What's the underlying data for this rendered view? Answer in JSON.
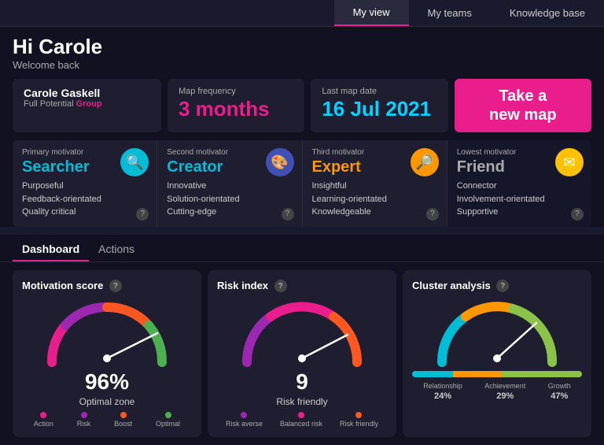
{
  "nav": {
    "tabs": [
      {
        "id": "my-view",
        "label": "My view",
        "active": true
      },
      {
        "id": "my-teams",
        "label": "My teams",
        "active": false
      },
      {
        "id": "knowledge-base",
        "label": "Knowledge base",
        "active": false
      }
    ]
  },
  "header": {
    "greeting": "Hi Carole",
    "welcome": "Welcome back"
  },
  "stats": {
    "user": {
      "name": "Carole Gaskell",
      "group_pre": "Full Potential ",
      "group_highlight": "Group"
    },
    "map_frequency": {
      "label": "Map frequency",
      "value": "3 months"
    },
    "last_map": {
      "label": "Last map date",
      "value": "16 Jul 2021"
    },
    "cta": {
      "line1": "Take a",
      "line2": "new map"
    }
  },
  "motivators": [
    {
      "label": "Primary motivator",
      "name": "Searcher",
      "color": "cyan",
      "icon": "🔍",
      "icon_color": "teal",
      "traits": [
        "Purposeful",
        "Feedback-orientated",
        "Quality critical"
      ]
    },
    {
      "label": "Second motivator",
      "name": "Creator",
      "color": "teal",
      "icon": "🎨",
      "icon_color": "blue",
      "traits": [
        "Innovative",
        "Solution-orientated",
        "Cutting-edge"
      ]
    },
    {
      "label": "Third motivator",
      "name": "Expert",
      "color": "orange",
      "icon": "🔎",
      "icon_color": "orange",
      "traits": [
        "Insightful",
        "Learning-orientated",
        "Knowledgeable"
      ]
    },
    {
      "label": "Lowest motivator",
      "name": "Friend",
      "color": "gray",
      "icon": "✉",
      "icon_color": "yellow",
      "traits": [
        "Connector",
        "Involvement-orientated",
        "Supportive"
      ],
      "lowest": true
    }
  ],
  "dashboard_tabs": [
    {
      "id": "dashboard",
      "label": "Dashboard",
      "active": true
    },
    {
      "id": "actions",
      "label": "Actions",
      "active": false
    }
  ],
  "gauges": {
    "motivation": {
      "title": "Motivation score",
      "value": "96%",
      "sub": "Optimal zone",
      "needle_angle": 155,
      "legend": [
        {
          "label": "Action",
          "color": "#e91e8c"
        },
        {
          "label": "Risk",
          "color": "#9c27b0"
        },
        {
          "label": "Boost",
          "color": "#ff5722"
        },
        {
          "label": "Optimal",
          "color": "#4caf50"
        }
      ],
      "segments": [
        {
          "color": "#e91e8c",
          "from": 180,
          "to": 225
        },
        {
          "color": "#9c27b0",
          "from": 225,
          "to": 270
        },
        {
          "color": "#ff5722",
          "from": 270,
          "to": 315
        },
        {
          "color": "#4caf50",
          "from": 315,
          "to": 360
        }
      ]
    },
    "risk": {
      "title": "Risk index",
      "value": "9",
      "sub": "Risk friendly",
      "legend": [
        {
          "label": "Risk averse",
          "color": "#9c27b0"
        },
        {
          "label": "Balanced risk",
          "color": "#e91e8c"
        },
        {
          "label": "Risk friendly",
          "color": "#ff5722"
        }
      ]
    },
    "cluster": {
      "title": "Cluster analysis",
      "bars": [
        {
          "label": "Relationship",
          "pct": "24%",
          "value": 24,
          "color": "#00bcd4"
        },
        {
          "label": "Achievement",
          "pct": "29%",
          "value": 29,
          "color": "#ff9800"
        },
        {
          "label": "Growth",
          "pct": "47%",
          "value": 47,
          "color": "#8bc34a"
        }
      ]
    }
  }
}
